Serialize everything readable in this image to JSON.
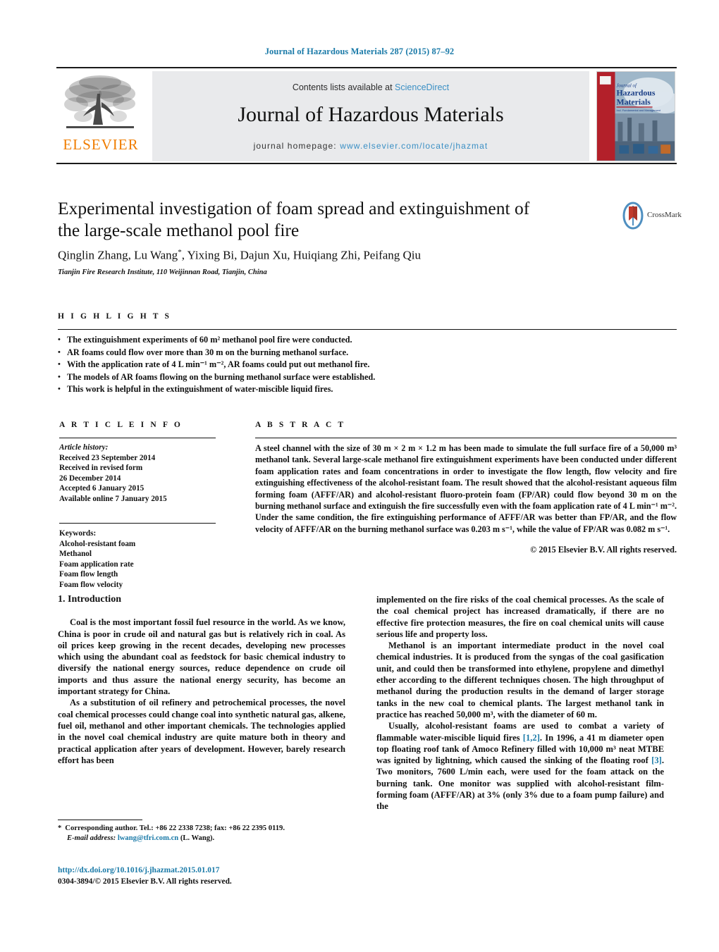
{
  "running_head": "Journal of Hazardous Materials 287 (2015) 87–92",
  "masthead": {
    "publisher_name": "ELSEVIER",
    "contents_prefix": "Contents lists available at ",
    "sciencedirect": "ScienceDirect",
    "journal_name": "Journal of Hazardous Materials",
    "homepage_prefix": "journal homepage:",
    "homepage_url": "www.elsevier.com/locate/jhazmat",
    "cover_title_line1": "Journal of",
    "cover_title_line2": "Hazardous",
    "cover_title_line3": "Materials"
  },
  "article": {
    "title": "Experimental investigation of foam spread and extinguishment of the large-scale methanol pool fire",
    "authors": "Qinglin Zhang, Lu Wang",
    "authors_rest": ", Yixing Bi, Dajun Xu, Huiqiang Zhi, Peifang Qiu",
    "corresponding_marker": "*",
    "affiliation": "Tianjin Fire Research Institute, 110 Weijinnan Road, Tianjin, China",
    "crossmark_label": "CrossMark"
  },
  "highlights": {
    "heading": "H I G H L I G H T S",
    "items": [
      "The extinguishment experiments of 60 m² methanol pool fire were conducted.",
      "AR foams could flow over more than 30 m on the burning methanol surface.",
      "With the application rate of 4 L min⁻¹ m⁻², AR foams could put out methanol fire.",
      "The models of AR foams flowing on the burning methanol surface were established.",
      "This work is helpful in the extinguishment of water-miscible liquid fires."
    ]
  },
  "article_info": {
    "heading": "A R T I C L E   I N F O",
    "history_label": "Article history:",
    "history": [
      "Received 23 September 2014",
      "Received in revised form",
      "26 December 2014",
      "Accepted 6 January 2015",
      "Available online 7 January 2015"
    ],
    "keywords_label": "Keywords:",
    "keywords": [
      "Alcohol-resistant foam",
      "Methanol",
      "Foam application rate",
      "Foam flow length",
      "Foam flow velocity"
    ]
  },
  "abstract": {
    "heading": "A B S T R A C T",
    "text": "A steel channel with the size of 30 m × 2 m × 1.2 m has been made to simulate the full surface fire of a 50,000 m³ methanol tank. Several large-scale methanol fire extinguishment experiments have been conducted under different foam application rates and foam concentrations in order to investigate the flow length, flow velocity and fire extinguishing effectiveness of the alcohol-resistant foam. The result showed that the alcohol-resistant aqueous film forming foam (AFFF/AR) and alcohol-resistant fluoro-protein foam (FP/AR) could flow beyond 30 m on the burning methanol surface and extinguish the fire successfully even with the foam application rate of 4 L min⁻¹ m⁻². Under the same condition, the fire extinguishing performance of AFFF/AR was better than FP/AR, and the flow velocity of AFFF/AR on the burning methanol surface was 0.203 m s⁻¹, while the value of FP/AR was 0.082 m s⁻¹.",
    "copyright": "© 2015 Elsevier B.V. All rights reserved."
  },
  "body": {
    "section_heading": "1. Introduction",
    "left_paragraphs": [
      "Coal is the most important fossil fuel resource in the world. As we know, China is poor in crude oil and natural gas but is relatively rich in coal. As oil prices keep growing in the recent decades, developing new processes which using the abundant coal as feedstock for basic chemical industry to diversify the national energy sources, reduce dependence on crude oil imports and thus assure the national energy security, has become an important strategy for China.",
      "As a substitution of oil refinery and petrochemical processes, the novel coal chemical processes could change coal into synthetic natural gas, alkene, fuel oil, methanol and other important chemicals. The technologies applied in the novel coal chemical industry are quite mature both in theory and practical application after years of development. However, barely research effort has been"
    ],
    "right_paragraphs": [
      "implemented on the fire risks of the coal chemical processes. As the scale of the coal chemical project has increased dramatically, if there are no effective fire protection measures, the fire on coal chemical units will cause serious life and property loss.",
      "Methanol is an important intermediate product in the novel coal chemical industries. It is produced from the syngas of the coal gasification unit, and could then be transformed into ethylene, propylene and dimethyl ether according to the different techniques chosen. The high throughput of methanol during the production results in the demand of larger storage tanks in the new coal to chemical plants. The largest methanol tank in practice has reached 50,000 m³, with the diameter of 60 m.",
      "Usually, alcohol-resistant foams are used to combat a variety of flammable water-miscible liquid fires [1,2]. In 1996, a 41 m diameter open top floating roof tank of Amoco Refinery filled with 10,000 m³ neat MTBE was ignited by lightning, which caused the sinking of the floating roof [3]. Two monitors, 7600 L/min each, were used for the foam attack on the burning tank. One monitor was supplied with alcohol-resistant film-forming foam (AFFF/AR) at 3% (only 3% due to a foam pump failure) and the"
    ],
    "reference_links": [
      "[1,2]",
      "[3]"
    ]
  },
  "footer": {
    "corresponding_note": "Corresponding author. Tel.: +86 22 2338 7238; fax: +86 22 2395 0119.",
    "email_label": "E-mail address:",
    "email": "lwang@tfri.com.cn",
    "email_owner": "(L. Wang).",
    "doi_url": "http://dx.doi.org/10.1016/j.jhazmat.2015.01.017",
    "issn_line": "0304-3894/© 2015 Elsevier B.V. All rights reserved."
  },
  "colors": {
    "link_blue": "#1a7aa8",
    "sciencedirect_blue": "#3a8fc4",
    "elsevier_orange": "#f07d00",
    "band_gray": "#e9eaec"
  }
}
